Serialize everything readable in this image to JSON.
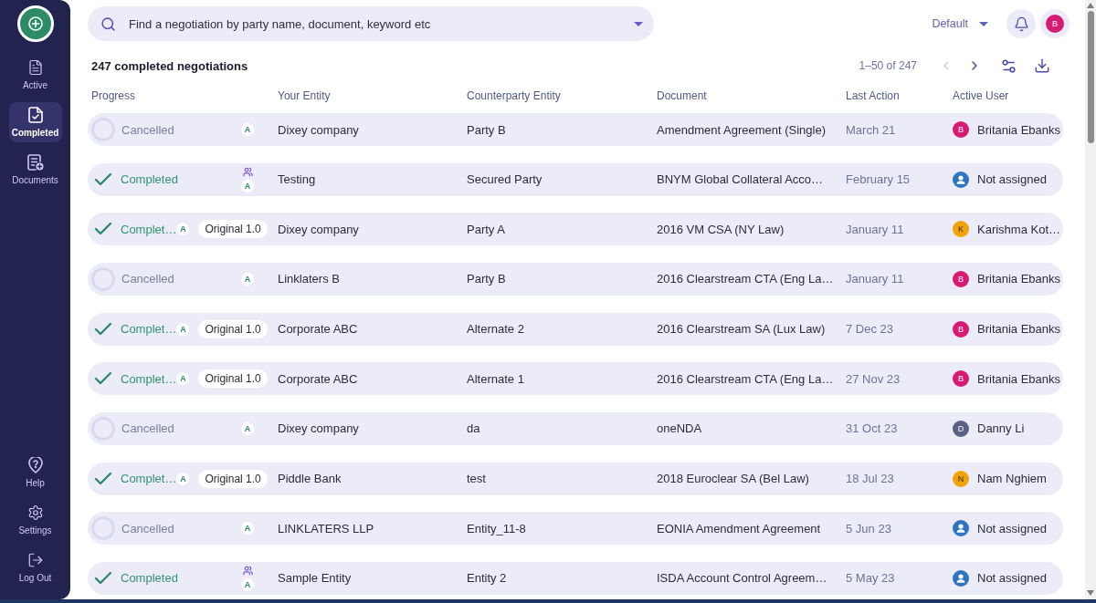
{
  "sidebar": {
    "nav": [
      {
        "label": "Active",
        "selected": false
      },
      {
        "label": "Completed",
        "selected": true
      },
      {
        "label": "Documents",
        "selected": false
      }
    ],
    "footer": [
      {
        "label": "Help"
      },
      {
        "label": "Settings"
      },
      {
        "label": "Log Out"
      }
    ]
  },
  "search": {
    "placeholder": "Find a negotiation by party name, document, keyword etc"
  },
  "view_selector": {
    "value": "Default"
  },
  "profile": {
    "initial": "B"
  },
  "title": "247 completed negotiations",
  "pagination": {
    "range": "1–50 of 247",
    "previous_disabled": true,
    "next_disabled": false
  },
  "table": {
    "columns": [
      "Progress",
      "Your Entity",
      "Counterparty Entity",
      "Document",
      "Last Action",
      "Active User"
    ],
    "rows": [
      {
        "status": {
          "kind": "cancelled",
          "label": "Cancelled"
        },
        "team": false,
        "marker": "A",
        "your_entity": "Dixey company",
        "counterparty_entity": "Party B",
        "document": "Amendment Agreement (Single)",
        "last_action": "March 21",
        "active_user": {
          "kind": "initial",
          "initial": "B",
          "name": "Britania Ebanks",
          "color": "#d81b72"
        }
      },
      {
        "status": {
          "kind": "completed",
          "label": "Completed"
        },
        "team": true,
        "marker": "A",
        "your_entity": "Testing",
        "counterparty_entity": "Secured Party",
        "document": "BNYM Global Collateral Acco…",
        "last_action": "February 15",
        "active_user": {
          "kind": "unassigned",
          "name": "Not assigned",
          "color": "#2f76c2"
        }
      },
      {
        "status": {
          "kind": "completed",
          "label": "Complet…"
        },
        "team": false,
        "marker": "A",
        "version": "Original 1.0",
        "your_entity": "Dixey company",
        "counterparty_entity": "Party A",
        "document": "2016 VM CSA (NY Law)",
        "last_action": "January 11",
        "active_user": {
          "kind": "initial",
          "initial": "K",
          "name": "Karishma Kot…",
          "color": "#f0a30a"
        }
      },
      {
        "status": {
          "kind": "cancelled",
          "label": "Cancelled"
        },
        "team": false,
        "marker": "A",
        "your_entity": "Linklaters B",
        "counterparty_entity": "Party B",
        "document": "2016 Clearstream CTA (Eng La…",
        "last_action": "January 11",
        "active_user": {
          "kind": "initial",
          "initial": "B",
          "name": "Britania Ebanks",
          "color": "#d81b72"
        }
      },
      {
        "status": {
          "kind": "completed",
          "label": "Complet…"
        },
        "team": false,
        "marker": "A",
        "version": "Original 1.0",
        "your_entity": "Corporate ABC",
        "counterparty_entity": "Alternate 2",
        "document": "2016 Clearstream SA (Lux Law)",
        "last_action": "7 Dec 23",
        "active_user": {
          "kind": "initial",
          "initial": "B",
          "name": "Britania Ebanks",
          "color": "#d81b72"
        }
      },
      {
        "status": {
          "kind": "completed",
          "label": "Complet…"
        },
        "team": false,
        "marker": "A",
        "version": "Original 1.0",
        "your_entity": "Corporate ABC",
        "counterparty_entity": "Alternate 1",
        "document": "2016 Clearstream CTA (Eng La…",
        "last_action": "27 Nov 23",
        "active_user": {
          "kind": "initial",
          "initial": "B",
          "name": "Britania Ebanks",
          "color": "#d81b72"
        }
      },
      {
        "status": {
          "kind": "cancelled",
          "label": "Cancelled"
        },
        "team": false,
        "marker": "A",
        "your_entity": "Dixey company",
        "counterparty_entity": "da",
        "document": "oneNDA",
        "last_action": "31 Oct 23",
        "active_user": {
          "kind": "initial",
          "initial": "D",
          "name": "Danny Li",
          "color": "#5a6283"
        }
      },
      {
        "status": {
          "kind": "completed",
          "label": "Complet…"
        },
        "team": false,
        "marker": "A",
        "version": "Original 1.0",
        "your_entity": "Piddle Bank",
        "counterparty_entity": "test",
        "document": "2018 Euroclear SA (Bel Law)",
        "last_action": "18 Jul 23",
        "active_user": {
          "kind": "initial",
          "initial": "N",
          "name": "Nam Nghiem",
          "color": "#f0a30a"
        }
      },
      {
        "status": {
          "kind": "cancelled",
          "label": "Cancelled"
        },
        "team": false,
        "marker": "A",
        "your_entity": "LINKLATERS LLP",
        "counterparty_entity": "Entity_11-8",
        "document": "EONIA Amendment Agreement",
        "last_action": "5 Jun 23",
        "active_user": {
          "kind": "unassigned",
          "name": "Not assigned",
          "color": "#2f76c2"
        }
      },
      {
        "status": {
          "kind": "completed",
          "label": "Completed"
        },
        "team": true,
        "marker": "A",
        "your_entity": "Sample Entity",
        "counterparty_entity": "Entity 2",
        "document": "ISDA Account Control Agreem…",
        "last_action": "5 May 23",
        "active_user": {
          "kind": "unassigned",
          "name": "Not assigned",
          "color": "#2f76c2"
        }
      }
    ]
  }
}
